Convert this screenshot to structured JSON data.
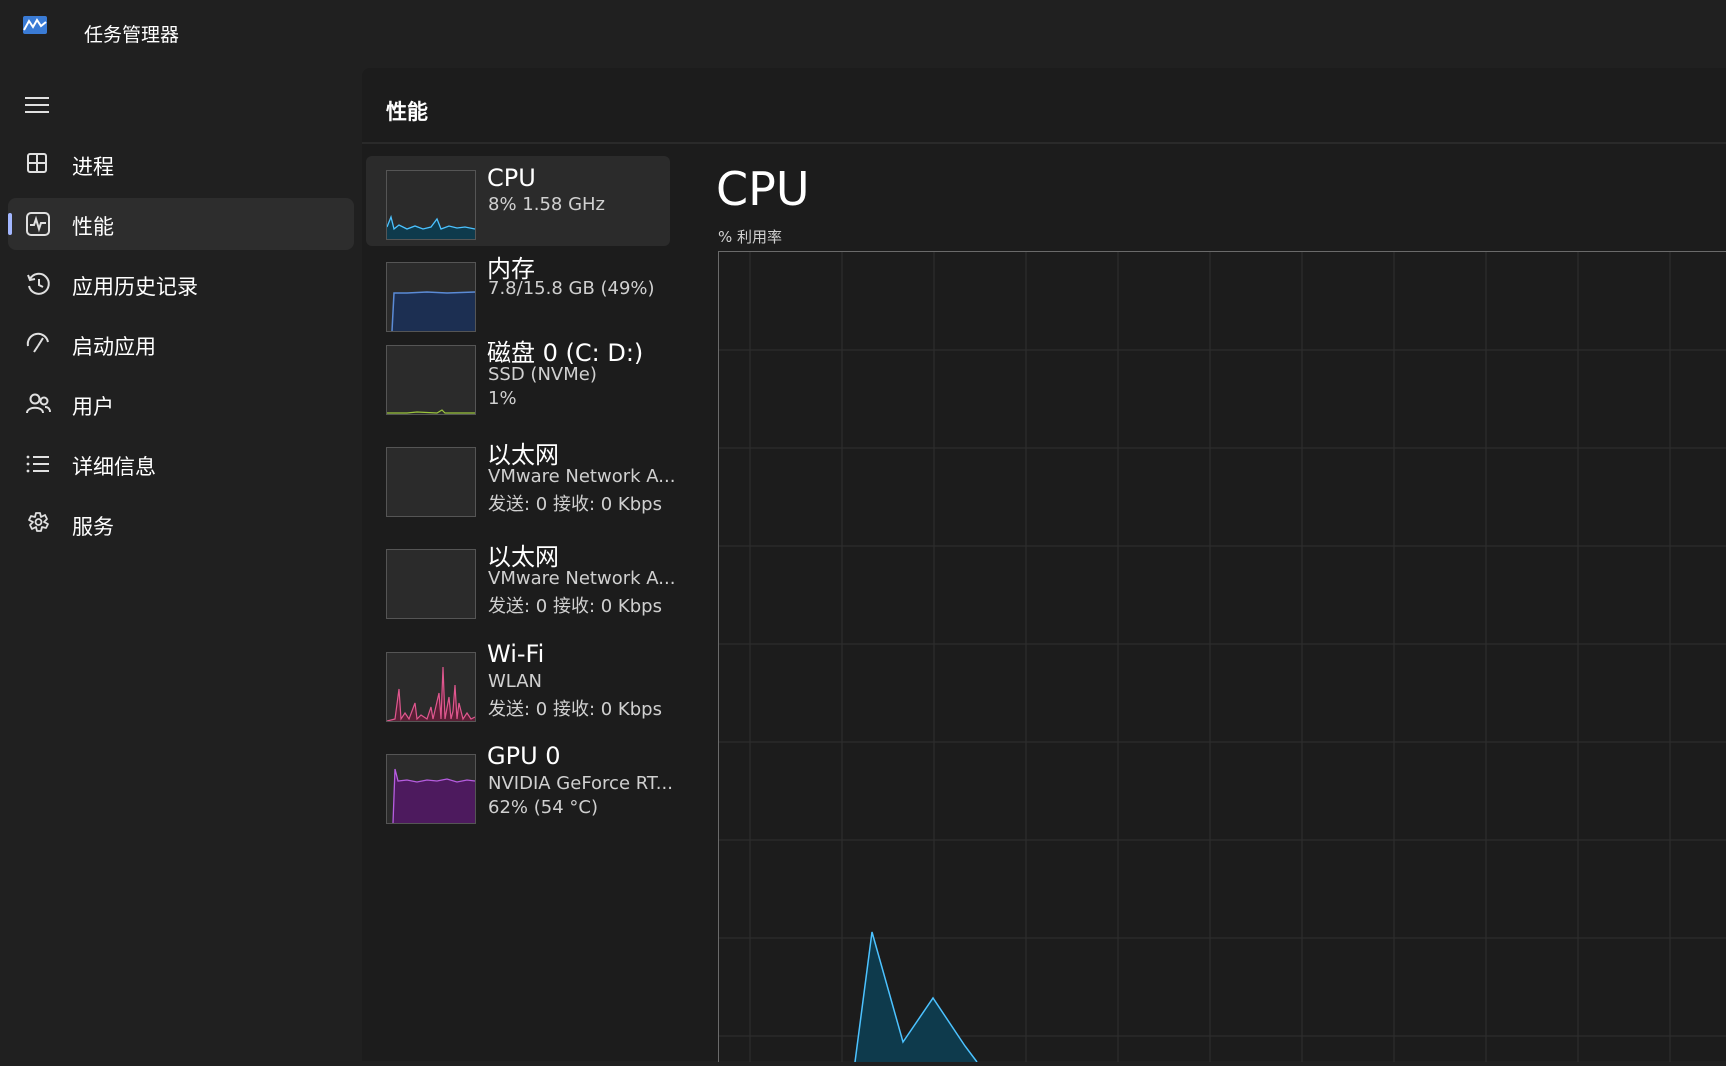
{
  "app": {
    "title": "任务管理器"
  },
  "nav": {
    "items": [
      {
        "label": "进程",
        "icon": "processes-icon"
      },
      {
        "label": "性能",
        "icon": "performance-icon",
        "active": true
      },
      {
        "label": "应用历史记录",
        "icon": "history-icon"
      },
      {
        "label": "启动应用",
        "icon": "startup-icon"
      },
      {
        "label": "用户",
        "icon": "users-icon"
      },
      {
        "label": "详细信息",
        "icon": "details-icon"
      },
      {
        "label": "服务",
        "icon": "services-icon"
      }
    ]
  },
  "page": {
    "title": "性能"
  },
  "resources": [
    {
      "name": "CPU",
      "lines": [
        "8%  1.58 GHz"
      ],
      "color": "#4cc2ff",
      "active": true
    },
    {
      "name": "内存",
      "lines": [
        "7.8/15.8 GB (49%)"
      ],
      "color": "#5b8bd6"
    },
    {
      "name": "磁盘 0 (C: D:)",
      "lines": [
        "SSD (NVMe)",
        "1%"
      ],
      "color": "#9bc53d"
    },
    {
      "name": "以太网",
      "lines": [
        "VMware Network A...",
        "发送: 0  接收: 0 Kbps"
      ],
      "color": "#d9a441"
    },
    {
      "name": "以太网",
      "lines": [
        "VMware Network A...",
        "发送: 0  接收: 0 Kbps"
      ],
      "color": "#d9a441"
    },
    {
      "name": "Wi-Fi",
      "lines": [
        "WLAN",
        "发送: 0  接收: 0 Kbps"
      ],
      "color": "#e0578f"
    },
    {
      "name": "GPU 0",
      "lines": [
        "NVIDIA GeForce RT...",
        "62%  (54 °C)"
      ],
      "color": "#b65de0"
    }
  ],
  "detail": {
    "title": "CPU",
    "subtitle": "% 利用率",
    "line_color": "#4cc2ff",
    "fill_color": "#0e3a4c"
  }
}
